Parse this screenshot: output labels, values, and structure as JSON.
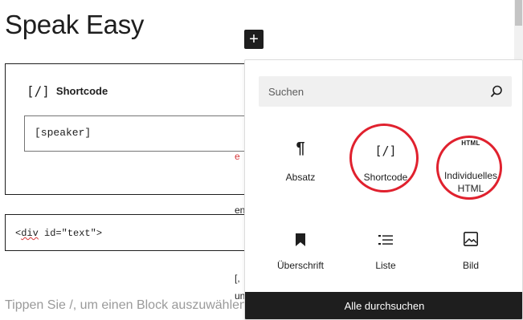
{
  "page": {
    "title": "Speak Easy",
    "placeholder": "Tippen Sie /, um einen Block auszuwählen"
  },
  "shortcode_block": {
    "icon_text": "[/]",
    "label": "Shortcode",
    "value": "[speaker]"
  },
  "html_block": {
    "code_prefix": "<",
    "code_tag": "div",
    "code_rest": " id=\"text\">"
  },
  "bleed_text": {
    "line1": "e",
    "line2": "en",
    "line3": "[,",
    "line4": "un"
  },
  "add_button": {
    "label": "+"
  },
  "inserter": {
    "search_placeholder": "Suchen",
    "blocks": [
      {
        "label": "Absatz",
        "icon": "paragraph-icon",
        "glyph": "¶"
      },
      {
        "label": "Shortcode",
        "icon": "shortcode-icon",
        "glyph": "[/]"
      },
      {
        "label": "Individuelles HTML",
        "icon": "html-icon",
        "glyph": "HTML"
      },
      {
        "label": "Überschrift",
        "icon": "bookmark-icon",
        "glyph": ""
      },
      {
        "label": "Liste",
        "icon": "list-icon",
        "glyph": ""
      },
      {
        "label": "Bild",
        "icon": "image-icon",
        "glyph": ""
      }
    ],
    "browse_all_label": "Alle durchsuchen"
  },
  "colors": {
    "highlight": "#e0212e",
    "dark": "#1e1e1e",
    "search_bg": "#f0f0f0"
  }
}
